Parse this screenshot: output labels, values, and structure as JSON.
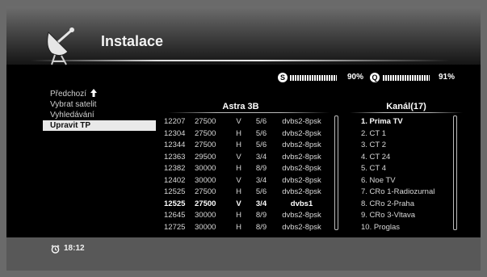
{
  "header": {
    "title": "Instalace"
  },
  "signal": {
    "strength_icon": "S",
    "strength_value": "90%",
    "quality_icon": "Q",
    "quality_value": "91%"
  },
  "menu": {
    "items": [
      {
        "label": "Předchozí",
        "icon": "arrow-up-icon",
        "selected": false
      },
      {
        "label": "Vybrat satelit",
        "selected": false
      },
      {
        "label": "Vyhledávání",
        "selected": false
      },
      {
        "label": "Upravit TP",
        "selected": true
      }
    ]
  },
  "transponders": {
    "header": "Astra 3B",
    "rows": [
      {
        "freq": "12207",
        "symrate": "27500",
        "pol": "V",
        "fec": "5/6",
        "mode": "dvbs2-8psk"
      },
      {
        "freq": "12304",
        "symrate": "27500",
        "pol": "H",
        "fec": "5/6",
        "mode": "dvbs2-8psk"
      },
      {
        "freq": "12344",
        "symrate": "27500",
        "pol": "H",
        "fec": "5/6",
        "mode": "dvbs2-8psk"
      },
      {
        "freq": "12363",
        "symrate": "29500",
        "pol": "V",
        "fec": "3/4",
        "mode": "dvbs2-8psk"
      },
      {
        "freq": "12382",
        "symrate": "30000",
        "pol": "H",
        "fec": "8/9",
        "mode": "dvbs2-8psk"
      },
      {
        "freq": "12402",
        "symrate": "30000",
        "pol": "V",
        "fec": "3/4",
        "mode": "dvbs2-8psk"
      },
      {
        "freq": "12525",
        "symrate": "27500",
        "pol": "H",
        "fec": "5/6",
        "mode": "dvbs2-8psk"
      },
      {
        "freq": "12525",
        "symrate": "27500",
        "pol": "V",
        "fec": "3/4",
        "mode": "dvbs1",
        "selected": true
      },
      {
        "freq": "12645",
        "symrate": "30000",
        "pol": "H",
        "fec": "8/9",
        "mode": "dvbs2-8psk"
      },
      {
        "freq": "12725",
        "symrate": "30000",
        "pol": "H",
        "fec": "8/9",
        "mode": "dvbs2-8psk"
      }
    ]
  },
  "channels": {
    "header": "Kanál(17)",
    "items": [
      {
        "label": "1. Prima TV",
        "selected": true
      },
      {
        "label": "2. CT 1"
      },
      {
        "label": "3. CT 2"
      },
      {
        "label": "4. CT 24"
      },
      {
        "label": "5. CT 4"
      },
      {
        "label": "6. Noe TV"
      },
      {
        "label": "7. CRo 1-Radiozurnal"
      },
      {
        "label": "8. CRo 2-Praha"
      },
      {
        "label": "9. CRo 3-Vltava"
      },
      {
        "label": "10. Proglas"
      }
    ]
  },
  "footer": {
    "time": "18:12",
    "clock_icon": "clock-icon"
  }
}
